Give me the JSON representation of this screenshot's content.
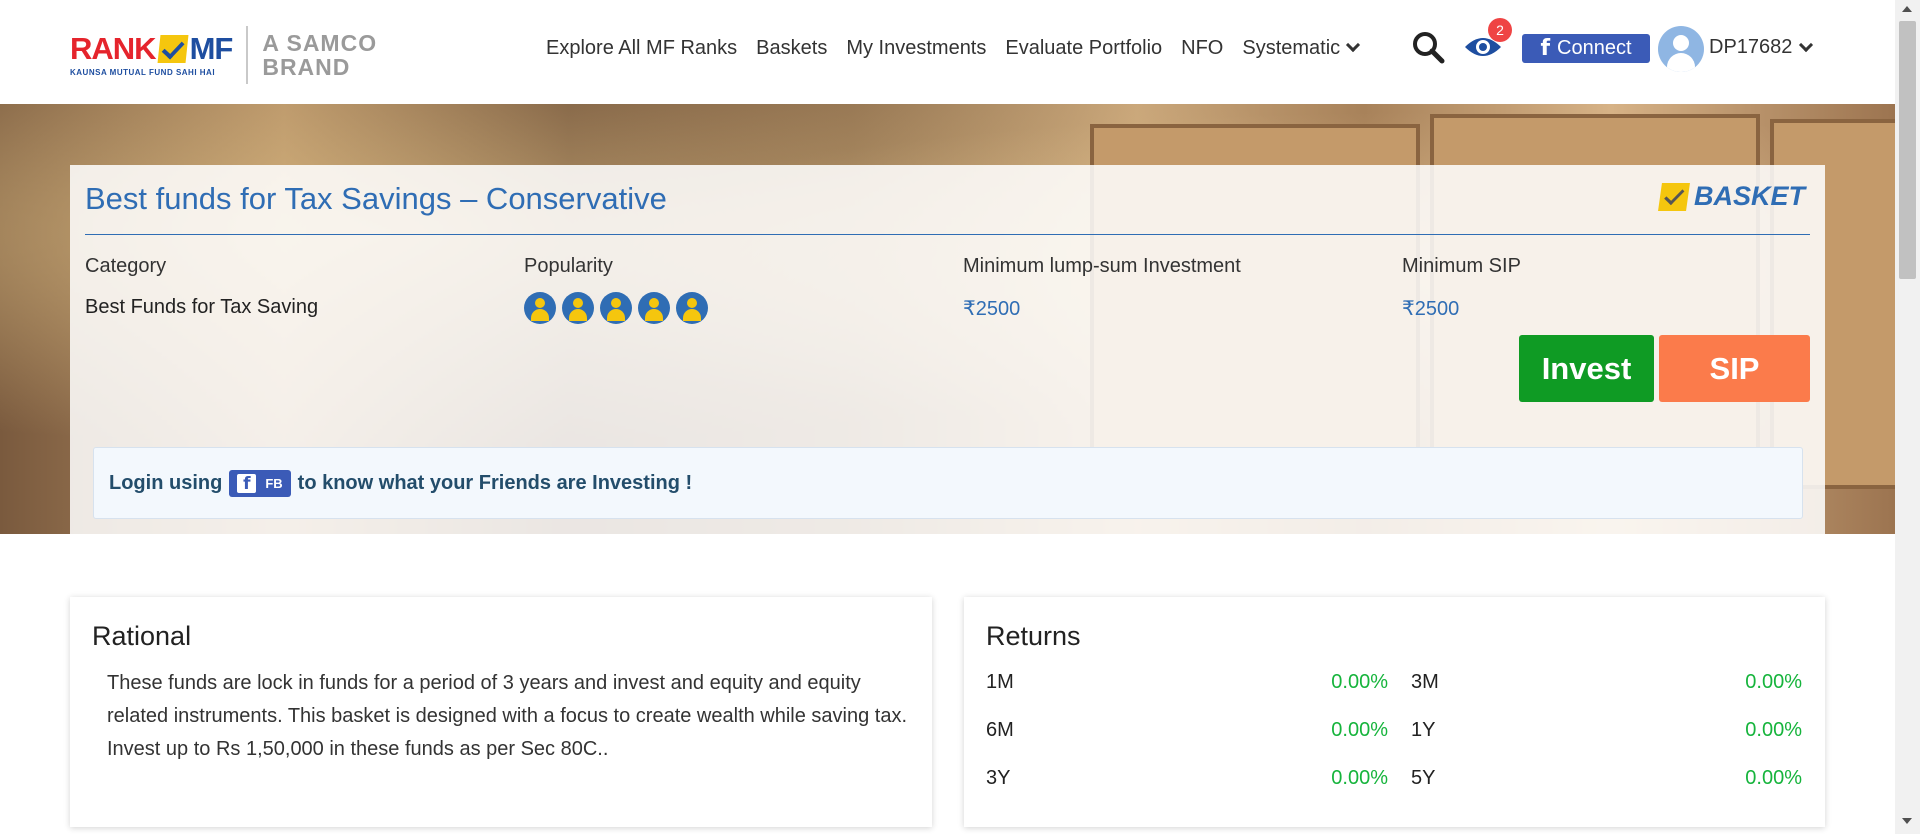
{
  "header": {
    "logo": {
      "rank": "RANK",
      "mf": "MF",
      "tagline": "KAUNSA MUTUAL FUND SAHI HAI",
      "brand_line1": "A SAMCO",
      "brand_line2": "BRAND"
    },
    "nav": [
      "Explore All MF Ranks",
      "Baskets",
      "My Investments",
      "Evaluate Portfolio",
      "NFO",
      "Systematic"
    ],
    "watchlist_count": "2",
    "connect_label": "Connect",
    "connect_icon": "f",
    "username": "DP17682"
  },
  "basket": {
    "title": "Best funds for Tax Savings – Conservative",
    "badge": "BASKET",
    "category_label": "Category",
    "category_value": "Best Funds for Tax Saving",
    "popularity_label": "Popularity",
    "popularity_rating": 5,
    "min_lumpsum_label": "Minimum lump-sum Investment",
    "min_lumpsum_value": "₹2500",
    "min_sip_label": "Minimum SIP",
    "min_sip_value": "₹2500",
    "invest_label": "Invest",
    "sip_label": "SIP"
  },
  "fb_notice": {
    "before": "Login using",
    "chip_icon": "f",
    "chip_label": "FB",
    "after": "to know what your Friends are Investing !"
  },
  "rational": {
    "title": "Rational",
    "text": "These funds are lock in funds for a period of 3 years and invest and equity and equity related instruments. This basket is designed with a focus to create wealth while saving tax. Invest up to Rs 1,50,000 in these funds as per Sec 80C.."
  },
  "returns": {
    "title": "Returns",
    "rows": [
      [
        {
          "label": "1M",
          "value": "0.00%"
        },
        {
          "label": "3M",
          "value": "0.00%"
        }
      ],
      [
        {
          "label": "6M",
          "value": "0.00%"
        },
        {
          "label": "1Y",
          "value": "0.00%"
        }
      ],
      [
        {
          "label": "3Y",
          "value": "0.00%"
        },
        {
          "label": "5Y",
          "value": "0.00%"
        }
      ]
    ]
  },
  "colors": {
    "brand_blue": "#2f6db4",
    "invest_green": "#0f9b24",
    "sip_orange": "#fb7b4b",
    "return_green": "#16b43c",
    "fb_blue": "#3b5bb7"
  }
}
